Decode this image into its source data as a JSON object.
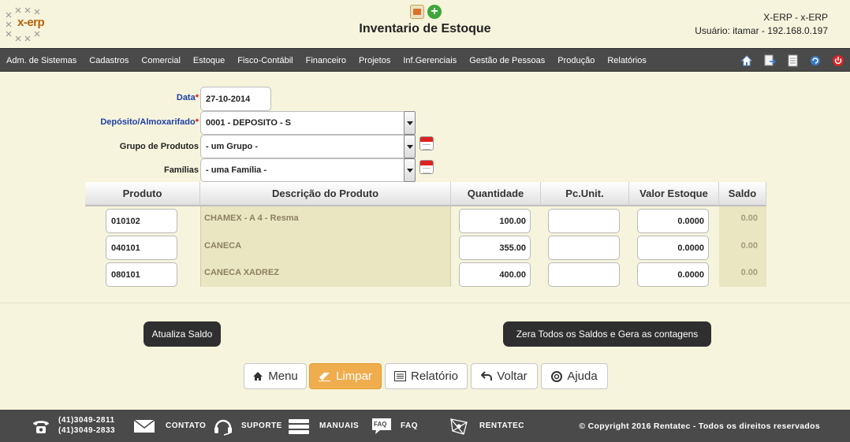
{
  "header": {
    "logo_text": "x-erp",
    "title": "Inventario de Estoque",
    "system": "X-ERP - x-ERP",
    "user": "Usuário: itamar - 192.168.0.197",
    "icons": [
      "pdf-icon",
      "add-icon"
    ]
  },
  "nav": {
    "items": [
      {
        "label": "Adm. de Sistemas"
      },
      {
        "label": "Cadastros"
      },
      {
        "label": "Comercial"
      },
      {
        "label": "Estoque"
      },
      {
        "label": "Fisco-Contábil"
      },
      {
        "label": "Financeiro"
      },
      {
        "label": "Projetos"
      },
      {
        "label": "Inf.Gerenciais"
      },
      {
        "label": "Gestão de Pessoas"
      },
      {
        "label": "Produção"
      },
      {
        "label": "Relatórios"
      }
    ],
    "icons": [
      "home-icon",
      "document-arrow-icon",
      "document-icon",
      "refresh-icon",
      "power-icon"
    ]
  },
  "form": {
    "data_label": "Data",
    "data_value": "27-10-2014",
    "deposito_label": "Depósito/Almoxarifado",
    "deposito_value": "0001 - DEPOSITO - S",
    "grupo_label": "Grupo de Produtos",
    "grupo_value": "- um Grupo -",
    "familias_label": "Famílias",
    "familias_value": "- uma Família -",
    "required_mark": "*"
  },
  "table": {
    "headers": {
      "produto": "Produto",
      "descricao": "Descrição do Produto",
      "quantidade": "Quantidade",
      "pcunit": "Pc.Unit.",
      "valor": "Valor Estoque",
      "saldo": "Saldo"
    },
    "rows": [
      {
        "produto": "010102",
        "descricao": "CHAMEX - A 4 - Resma",
        "quantidade": "100.00",
        "pcunit": "",
        "valor": "0.0000",
        "saldo": "0.00"
      },
      {
        "produto": "040101",
        "descricao": "CANECA",
        "quantidade": "355.00",
        "pcunit": "",
        "valor": "0.0000",
        "saldo": "0.00"
      },
      {
        "produto": "080101",
        "descricao": "CANECA XADREZ",
        "quantidade": "400.00",
        "pcunit": "",
        "valor": "0.0000",
        "saldo": "0.00"
      }
    ]
  },
  "buttons": {
    "atualiza": "Atualiza Saldo",
    "zera": "Zera Todos os Saldos e Gera as contagens",
    "menu": "Menu",
    "limpar": "Limpar",
    "relatorio": "Relatório",
    "voltar": "Voltar",
    "ajuda": "Ajuda"
  },
  "footer": {
    "phone1": "(41)3049-2811",
    "phone2": "(41)3049-2833",
    "contato": "CONTATO",
    "suporte": "SUPORTE",
    "manuais": "MANUAIS",
    "faq": "FAQ",
    "faq_icon_text": "FAQ",
    "rentatec": "RENTATEC",
    "copyright": "© Copyright 2016 Rentatec - Todos os direitos reservados"
  },
  "colors": {
    "background": "#f6f4dc",
    "nav": "#4a4a4a",
    "label_blue": "#1d3fa8",
    "required": "#d11111",
    "active_button": "#f0ad4e"
  }
}
